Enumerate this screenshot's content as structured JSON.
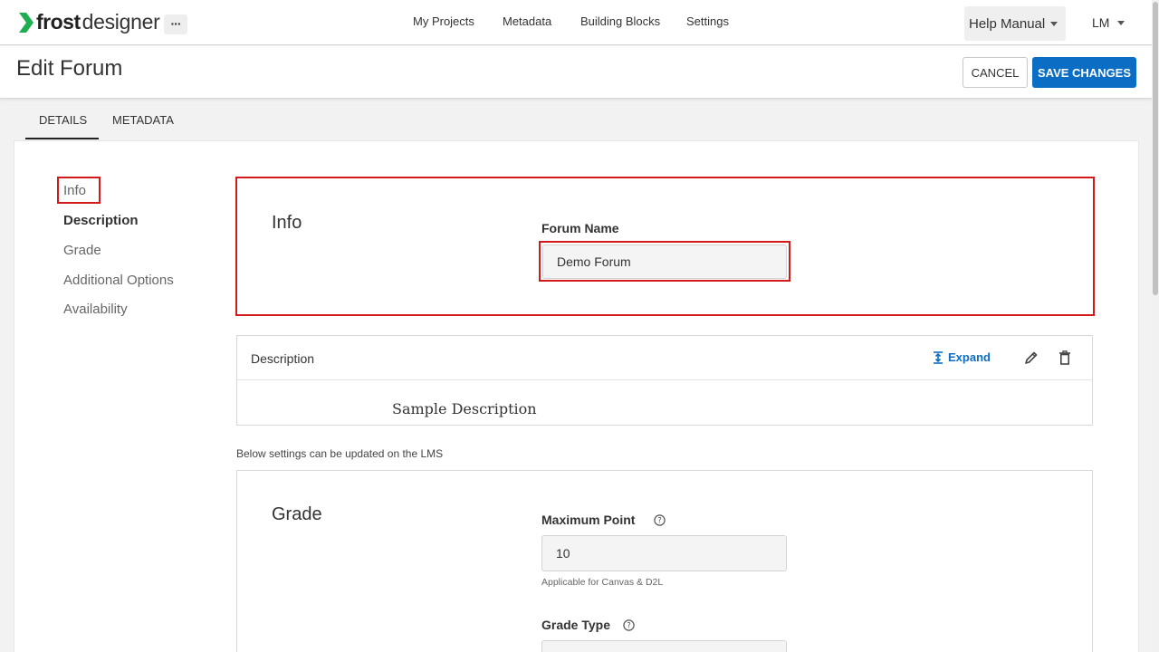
{
  "brand": {
    "name_bold": "frost",
    "name_light": "designer",
    "accent": "#1fae4f"
  },
  "nav": {
    "more": "···",
    "items": [
      "My Projects",
      "Metadata",
      "Building Blocks",
      "Settings"
    ],
    "help_label": "Help Manual",
    "user_initials": "LM"
  },
  "header": {
    "title": "Edit Forum",
    "cancel_label": "CANCEL",
    "save_label": "SAVE CHANGES",
    "primary_color": "#0b6dc4"
  },
  "tabs": [
    {
      "label": "DETAILS",
      "active": true
    },
    {
      "label": "METADATA",
      "active": false
    }
  ],
  "sidebar": {
    "items": [
      {
        "label": "Info",
        "active": false,
        "highlighted": true
      },
      {
        "label": "Description",
        "active": true
      },
      {
        "label": "Grade"
      },
      {
        "label": "Additional Options"
      },
      {
        "label": "Availability"
      }
    ]
  },
  "info": {
    "title": "Info",
    "forum_name_label": "Forum Name",
    "forum_name_value": "Demo Forum"
  },
  "description": {
    "title": "Description",
    "expand_label": "Expand",
    "body": "Sample Description"
  },
  "lms_note": "Below settings can be updated on the LMS",
  "grade": {
    "title": "Grade",
    "max_point_label": "Maximum Point",
    "max_point_value": "10",
    "max_point_hint": "Applicable for Canvas & D2L",
    "grade_type_label": "Grade Type",
    "grade_type_value": ""
  },
  "highlight_color": "#d11a1a"
}
